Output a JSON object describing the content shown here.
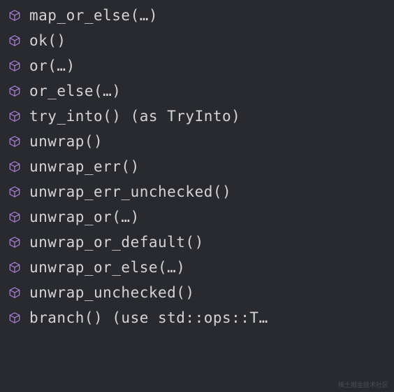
{
  "completions": [
    {
      "label": "map_or_else(…)"
    },
    {
      "label": "ok()"
    },
    {
      "label": "or(…)"
    },
    {
      "label": "or_else(…)"
    },
    {
      "label": "try_into() (as TryInto)"
    },
    {
      "label": "unwrap()"
    },
    {
      "label": "unwrap_err()"
    },
    {
      "label": "unwrap_err_unchecked()"
    },
    {
      "label": "unwrap_or(…)"
    },
    {
      "label": "unwrap_or_default()"
    },
    {
      "label": "unwrap_or_else(…)"
    },
    {
      "label": "unwrap_unchecked()"
    },
    {
      "label": "branch() (use std::ops::T…"
    }
  ],
  "iconColor": "#b180d7",
  "watermark": "稀土掘金技术社区"
}
